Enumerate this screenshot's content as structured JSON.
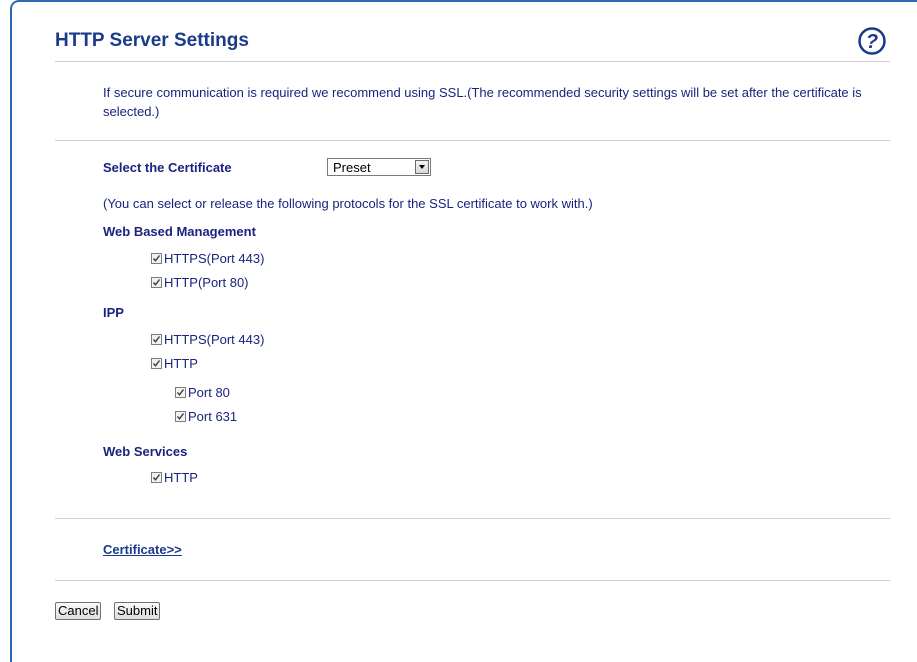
{
  "page": {
    "title": "HTTP Server Settings",
    "help_icon": "help-question-icon",
    "intro": "If secure communication is required we recommend using SSL.(The recommended security settings will be set after the certificate is selected.)"
  },
  "certificate": {
    "label": "Select the Certificate",
    "selected": "Preset"
  },
  "protocols_note": "(You can select or release the following protocols for the SSL certificate to work with.)",
  "web_based_management": {
    "heading": "Web Based Management",
    "https_label": "HTTPS(Port 443)",
    "https_checked": true,
    "http_label": "HTTP(Port 80)",
    "http_checked": true
  },
  "ipp": {
    "heading": "IPP",
    "https_label": "HTTPS(Port 443)",
    "https_checked": true,
    "http_label": "HTTP",
    "http_checked": true,
    "port80_label": "Port 80",
    "port80_checked": true,
    "port631_label": "Port 631",
    "port631_checked": true
  },
  "web_services": {
    "heading": "Web Services",
    "http_label": "HTTP",
    "http_checked": true
  },
  "certificate_link": "Certificate>>",
  "buttons": {
    "cancel": "Cancel",
    "submit": "Submit"
  },
  "colors": {
    "frame_border": "#2b6cb0",
    "title": "#1a3a8a",
    "text": "#1a237e"
  }
}
